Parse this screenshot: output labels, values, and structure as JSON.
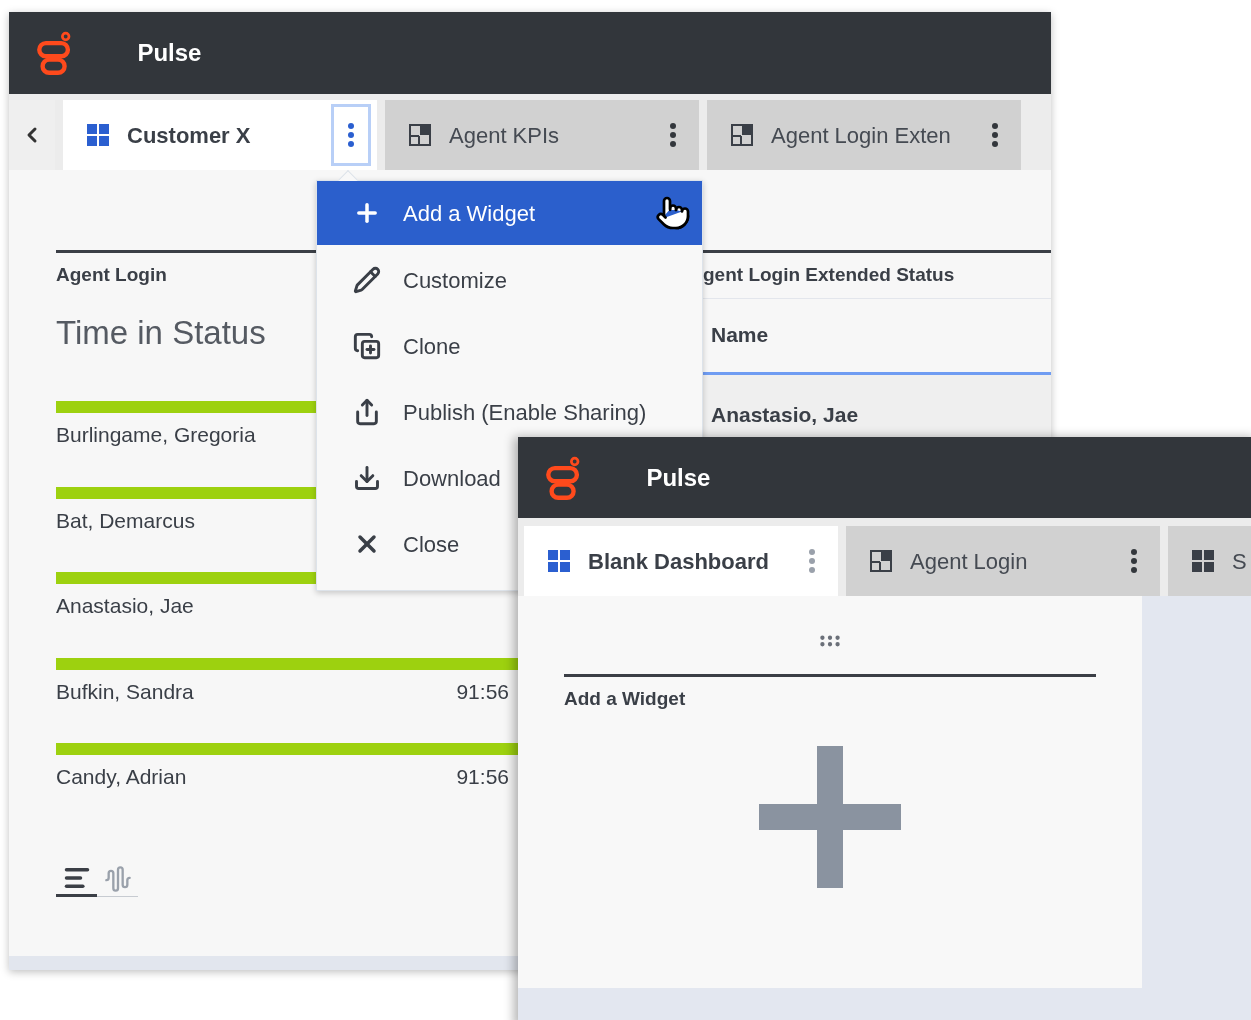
{
  "back_window": {
    "app_title": "Pulse",
    "tabs": [
      {
        "label": "Customer X",
        "kind": "dashboard",
        "selected": true
      },
      {
        "label": "Agent KPIs",
        "kind": "widget",
        "selected": false
      },
      {
        "label": "Agent Login Exten",
        "kind": "widget",
        "selected": false
      }
    ],
    "status_widget": {
      "source": "Agent Login",
      "title": "Time in Status",
      "rows": [
        {
          "name": "Burlingame, Gregoria"
        },
        {
          "name": "Bat, Demarcus"
        },
        {
          "name": "Anastasio, Jae"
        },
        {
          "name": "Bufkin, Sandra",
          "value": "91:56"
        },
        {
          "name": "Candy, Adrian",
          "value": "91:56"
        }
      ],
      "views": [
        {
          "kind": "bars",
          "selected": true
        },
        {
          "kind": "wave",
          "selected": false
        }
      ]
    },
    "table_widget": {
      "source": "gent Login Extended Status",
      "columns": [
        "Name"
      ],
      "rows": [
        [
          "Anastasio, Jae"
        ]
      ]
    }
  },
  "tab_menu": {
    "items": [
      {
        "label": "Add a Widget",
        "selected": true
      },
      {
        "label": "Customize",
        "selected": false
      },
      {
        "label": "Clone",
        "selected": false
      },
      {
        "label": "Publish (Enable Sharing)",
        "selected": false
      },
      {
        "label": "Download",
        "selected": false
      },
      {
        "label": "Close",
        "selected": false
      }
    ]
  },
  "front_window": {
    "app_title": "Pulse",
    "tabs": [
      {
        "label": "Blank Dashboard",
        "kind": "dashboard",
        "selected": true
      },
      {
        "label": "Agent Login",
        "kind": "widget",
        "selected": false
      },
      {
        "label": "S",
        "kind": "dashboard",
        "selected": false
      }
    ],
    "widget": {
      "title": "Add a Widget"
    }
  }
}
